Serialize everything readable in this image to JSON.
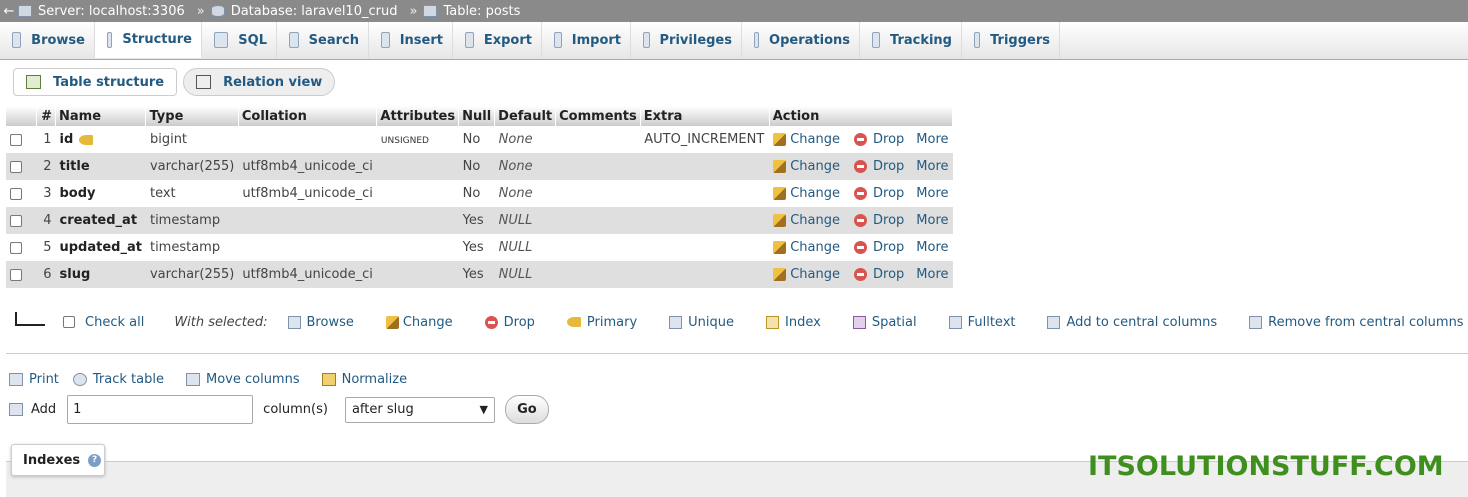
{
  "breadcrumb": {
    "back": "←",
    "server": "Server: localhost:3306",
    "database": "Database: laravel10_crud",
    "table": "Table: posts",
    "sep": "»"
  },
  "tabs": [
    {
      "label": "Browse",
      "icon": "browse-icon"
    },
    {
      "label": "Structure",
      "icon": "structure-icon",
      "active": true
    },
    {
      "label": "SQL",
      "icon": "sql-icon"
    },
    {
      "label": "Search",
      "icon": "search-icon"
    },
    {
      "label": "Insert",
      "icon": "insert-icon"
    },
    {
      "label": "Export",
      "icon": "export-icon"
    },
    {
      "label": "Import",
      "icon": "import-icon"
    },
    {
      "label": "Privileges",
      "icon": "privileges-icon"
    },
    {
      "label": "Operations",
      "icon": "operations-icon"
    },
    {
      "label": "Tracking",
      "icon": "tracking-icon"
    },
    {
      "label": "Triggers",
      "icon": "triggers-icon"
    }
  ],
  "subtabs": {
    "table_structure": "Table structure",
    "relation_view": "Relation view"
  },
  "columns_header": {
    "num": "#",
    "name": "Name",
    "type": "Type",
    "collation": "Collation",
    "attributes": "Attributes",
    "null": "Null",
    "default": "Default",
    "comments": "Comments",
    "extra": "Extra",
    "action": "Action"
  },
  "rows": [
    {
      "num": "1",
      "name": "id",
      "primary_key": true,
      "type": "bigint",
      "collation": "",
      "attributes": "UNSIGNED",
      "null": "No",
      "default": "None",
      "extra": "AUTO_INCREMENT"
    },
    {
      "num": "2",
      "name": "title",
      "type": "varchar(255)",
      "collation": "utf8mb4_unicode_ci",
      "attributes": "",
      "null": "No",
      "default": "None",
      "extra": ""
    },
    {
      "num": "3",
      "name": "body",
      "type": "text",
      "collation": "utf8mb4_unicode_ci",
      "attributes": "",
      "null": "No",
      "default": "None",
      "extra": ""
    },
    {
      "num": "4",
      "name": "created_at",
      "type": "timestamp",
      "collation": "",
      "attributes": "",
      "null": "Yes",
      "default": "NULL",
      "extra": ""
    },
    {
      "num": "5",
      "name": "updated_at",
      "type": "timestamp",
      "collation": "",
      "attributes": "",
      "null": "Yes",
      "default": "NULL",
      "extra": ""
    },
    {
      "num": "6",
      "name": "slug",
      "type": "varchar(255)",
      "collation": "utf8mb4_unicode_ci",
      "attributes": "",
      "null": "Yes",
      "default": "NULL",
      "extra": ""
    }
  ],
  "row_actions": {
    "change": "Change",
    "drop": "Drop",
    "more": "More"
  },
  "with_selected": {
    "check_all": "Check all",
    "label": "With selected:",
    "browse": "Browse",
    "change": "Change",
    "drop": "Drop",
    "primary": "Primary",
    "unique": "Unique",
    "index": "Index",
    "spatial": "Spatial",
    "fulltext": "Fulltext",
    "add_central": "Add to central columns",
    "remove_central": "Remove from central columns"
  },
  "tools": {
    "print": "Print",
    "track": "Track table",
    "move": "Move columns",
    "normalize": "Normalize"
  },
  "add_columns": {
    "label": "Add",
    "value": "1",
    "unit": "column(s)",
    "position": "after slug",
    "go": "Go"
  },
  "indexes": {
    "label": "Indexes",
    "help": "?"
  },
  "watermark": "ITSOLUTIONSTUFF.COM"
}
